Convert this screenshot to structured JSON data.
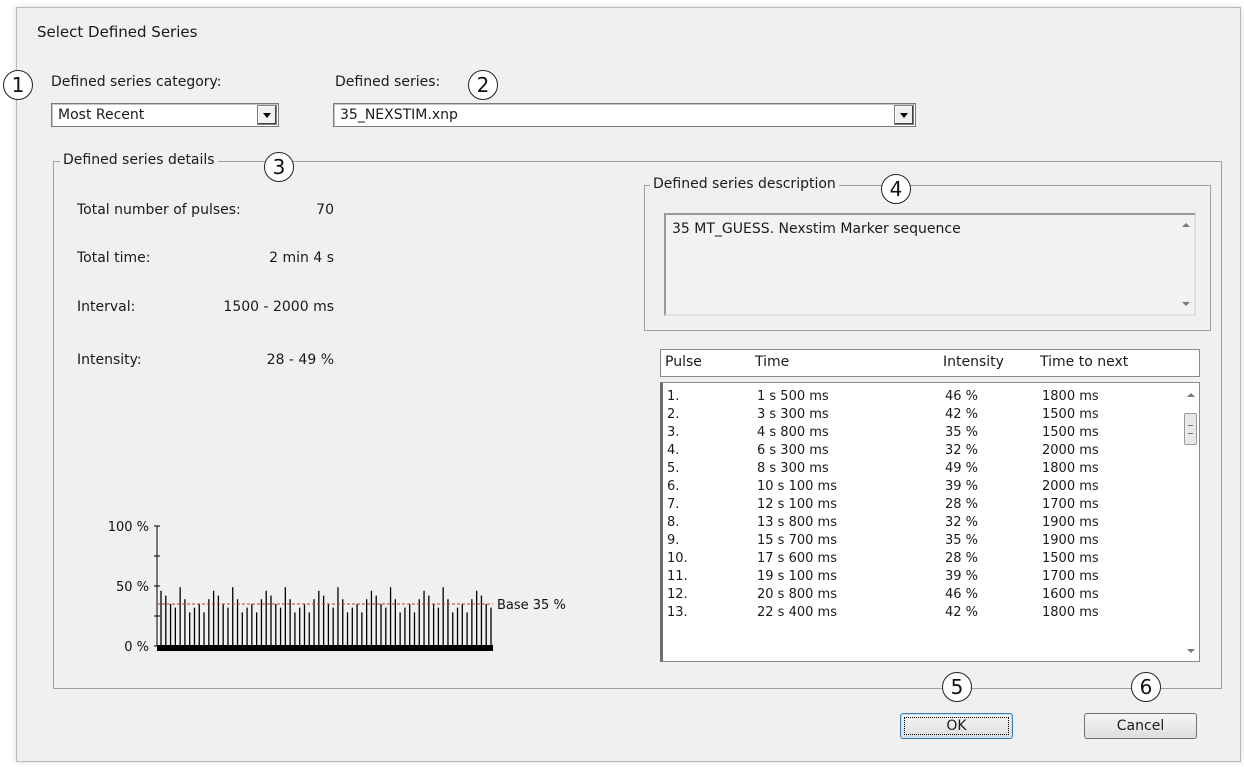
{
  "dialog": {
    "title": "Select Defined Series",
    "category_label": "Defined series category:",
    "category_value": "Most Recent",
    "series_label": "Defined series:",
    "series_value": "35_NEXSTIM.xnp",
    "details_legend": "Defined series details",
    "description_legend": "Defined series description",
    "description_text": "35 MT_GUESS. Nexstim Marker sequence",
    "ok_label": "OK",
    "cancel_label": "Cancel"
  },
  "callouts": [
    "1",
    "2",
    "3",
    "4",
    "5",
    "6"
  ],
  "details": [
    {
      "label": "Total number of pulses:",
      "value": "70"
    },
    {
      "label": "Total time:",
      "value": "2 min 4 s"
    },
    {
      "label": "Interval:",
      "value": "1500 - 2000 ms"
    },
    {
      "label": "Intensity:",
      "value": "28 - 49 %"
    }
  ],
  "table": {
    "columns": [
      "Pulse",
      "Time",
      "Intensity",
      "Time to next"
    ],
    "rows": [
      [
        "1.",
        "1 s 500 ms",
        "46 %",
        "1800 ms"
      ],
      [
        "2.",
        "3 s 300 ms",
        "42 %",
        "1500 ms"
      ],
      [
        "3.",
        "4 s 800 ms",
        "35 %",
        "1500 ms"
      ],
      [
        "4.",
        "6 s 300 ms",
        "32 %",
        "2000 ms"
      ],
      [
        "5.",
        "8 s 300 ms",
        "49 %",
        "1800 ms"
      ],
      [
        "6.",
        "10 s 100 ms",
        "39 %",
        "2000 ms"
      ],
      [
        "7.",
        "12 s 100 ms",
        "28 %",
        "1700 ms"
      ],
      [
        "8.",
        "13 s 800 ms",
        "32 %",
        "1900 ms"
      ],
      [
        "9.",
        "15 s 700 ms",
        "35 %",
        "1900 ms"
      ],
      [
        "10.",
        "17 s 600 ms",
        "28 %",
        "1500 ms"
      ],
      [
        "11.",
        "19 s 100 ms",
        "39 %",
        "1700 ms"
      ],
      [
        "12.",
        "20 s 800 ms",
        "46 %",
        "1600 ms"
      ],
      [
        "13.",
        "22 s 400 ms",
        "42 %",
        "1800 ms"
      ]
    ]
  },
  "chart_data": {
    "type": "bar",
    "title": "",
    "ylim": [
      0,
      100
    ],
    "ytick_labels": [
      "100 %",
      "50 %",
      "0 %"
    ],
    "yticks": [
      100,
      50,
      0
    ],
    "baseline_value": 35,
    "baseline_label": "Base 35 %",
    "values": [
      46,
      42,
      35,
      32,
      49,
      39,
      28,
      32,
      35,
      28,
      39,
      46,
      42,
      35,
      32,
      49,
      39,
      28,
      32,
      35,
      28,
      39,
      46,
      42,
      35,
      32,
      49,
      39,
      28,
      32,
      35,
      28,
      39,
      46,
      42,
      35,
      32,
      49,
      39,
      28,
      32,
      35,
      28,
      39,
      46,
      42,
      35,
      32,
      49,
      39,
      28,
      32,
      35,
      28,
      39,
      46,
      42,
      35,
      32,
      49,
      39,
      28,
      32,
      35,
      28,
      39,
      46,
      42,
      35,
      32
    ],
    "colors": {
      "bars": "#000000",
      "baseline": "#c0392b"
    }
  }
}
